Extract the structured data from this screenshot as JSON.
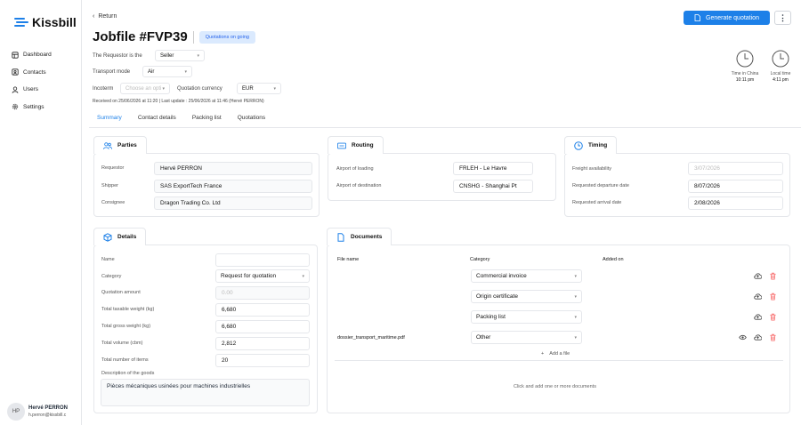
{
  "brand": "Kissbill",
  "sidebar": {
    "items": [
      {
        "label": "Dashboard"
      },
      {
        "label": "Contacts"
      },
      {
        "label": "Users"
      },
      {
        "label": "Settings"
      }
    ]
  },
  "user": {
    "initials": "HP",
    "name": "Hervé PERRON",
    "email": "h.perron@kissbill.c"
  },
  "header": {
    "return": "Return",
    "title": "Jobfile #FVP39",
    "status": "Quotations on going",
    "generate": "Generate quotation",
    "more": "⋮"
  },
  "form": {
    "requestor_label": "The Requestor is the",
    "requestor_value": "Seller",
    "transport_label": "Transport mode",
    "transport_value": "Air",
    "incoterm_label": "Incoterm",
    "incoterm_placeholder": "Choose an opti",
    "currency_label": "Quotation currency",
    "currency_value": "EUR"
  },
  "received": "Received on 25/06/2026 at 11:20  |  Last update : 25/06/2026 at 11:46 (Hervé PERRON)",
  "clocks": [
    {
      "label": "Time in China",
      "time": "10:11 pm"
    },
    {
      "label": "Local time",
      "time": "4:11 pm"
    }
  ],
  "tabs": [
    {
      "label": "Summary"
    },
    {
      "label": "Contact details"
    },
    {
      "label": "Packing list"
    },
    {
      "label": "Quotations"
    }
  ],
  "parties": {
    "title": "Parties",
    "rows": [
      {
        "label": "Requestor",
        "value": "Hervé PERRON"
      },
      {
        "label": "Shipper",
        "value": "SAS ExportTech France"
      },
      {
        "label": "Consignee",
        "value": "Dragon Trading Co. Ltd"
      }
    ]
  },
  "routing": {
    "title": "Routing",
    "rows": [
      {
        "label": "Airport of loading",
        "value": "FRLEH - Le Havre"
      },
      {
        "label": "Airport of destination",
        "value": "CNSHG - Shanghai Pt"
      }
    ]
  },
  "timing": {
    "title": "Timing",
    "rows": [
      {
        "label": "Freight availability",
        "value": "3/07/2026"
      },
      {
        "label": "Requested departure date",
        "value": "8/07/2026"
      },
      {
        "label": "Requested arrival date",
        "value": "2/08/2026"
      }
    ]
  },
  "details": {
    "title": "Details",
    "rows": [
      {
        "label": "Name",
        "value": ""
      },
      {
        "label": "Category",
        "value": "Request for quotation"
      },
      {
        "label": "Quotation amount",
        "value": "0.00"
      },
      {
        "label": "Total taxable weight (kg)",
        "value": "6,680"
      },
      {
        "label": "Total gross weight (kg)",
        "value": "6,680"
      },
      {
        "label": "Total volume (cbm)",
        "value": "2,812"
      },
      {
        "label": "Total number of items",
        "value": "20"
      }
    ],
    "desc_label": "Description of the goods",
    "desc_value": "Pièces mécaniques usinées pour machines industrielles"
  },
  "documents": {
    "title": "Documents",
    "col_file": "File name",
    "col_category": "Category",
    "col_added": "Added on",
    "rows": [
      {
        "file": "",
        "category": "Commercial invoice"
      },
      {
        "file": "",
        "category": "Origin certificate"
      },
      {
        "file": "",
        "category": "Packing list"
      },
      {
        "file": "dossier_transport_maritime.pdf",
        "category": "Other"
      }
    ],
    "add": "Add a file",
    "drop": "Click and add one or more documents"
  },
  "colors": {
    "accent": "#1d80e8",
    "badge_bg": "#dbeafe",
    "delete": "#f87171"
  }
}
